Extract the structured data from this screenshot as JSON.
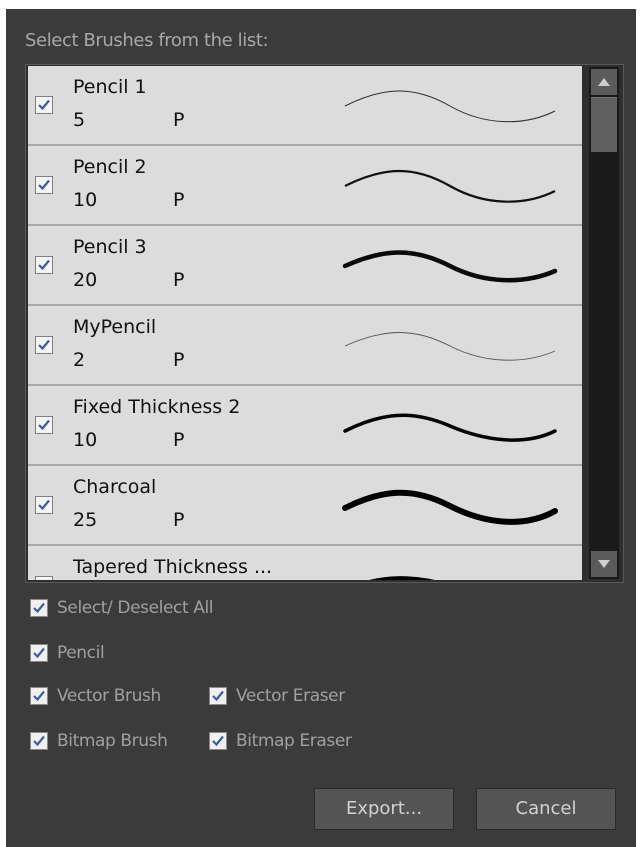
{
  "dialog": {
    "header": "Select Brushes from the list:"
  },
  "brushes": [
    {
      "name": "Pencil 1",
      "size": "5",
      "type": "P",
      "checked": true
    },
    {
      "name": "Pencil 2",
      "size": "10",
      "type": "P",
      "checked": true
    },
    {
      "name": "Pencil 3",
      "size": "20",
      "type": "P",
      "checked": true
    },
    {
      "name": "MyPencil",
      "size": "2",
      "type": "P",
      "checked": true
    },
    {
      "name": "Fixed Thickness 2",
      "size": "10",
      "type": "P",
      "checked": true
    },
    {
      "name": "Charcoal",
      "size": "25",
      "type": "P",
      "checked": true
    },
    {
      "name": "Tapered Thickness ...",
      "size": "",
      "type": "",
      "checked": true
    }
  ],
  "options": {
    "select_all": "Select/ Deselect All",
    "pencil": "Pencil",
    "vector_brush": "Vector Brush",
    "vector_eraser": "Vector Eraser",
    "bitmap_brush": "Bitmap Brush",
    "bitmap_eraser": "Bitmap Eraser"
  },
  "buttons": {
    "export": "Export...",
    "cancel": "Cancel"
  },
  "colors": {
    "dialog_bg": "#3b3b3b",
    "row_bg": "#dcdcdc",
    "check_mark": "#3b5ca8"
  }
}
